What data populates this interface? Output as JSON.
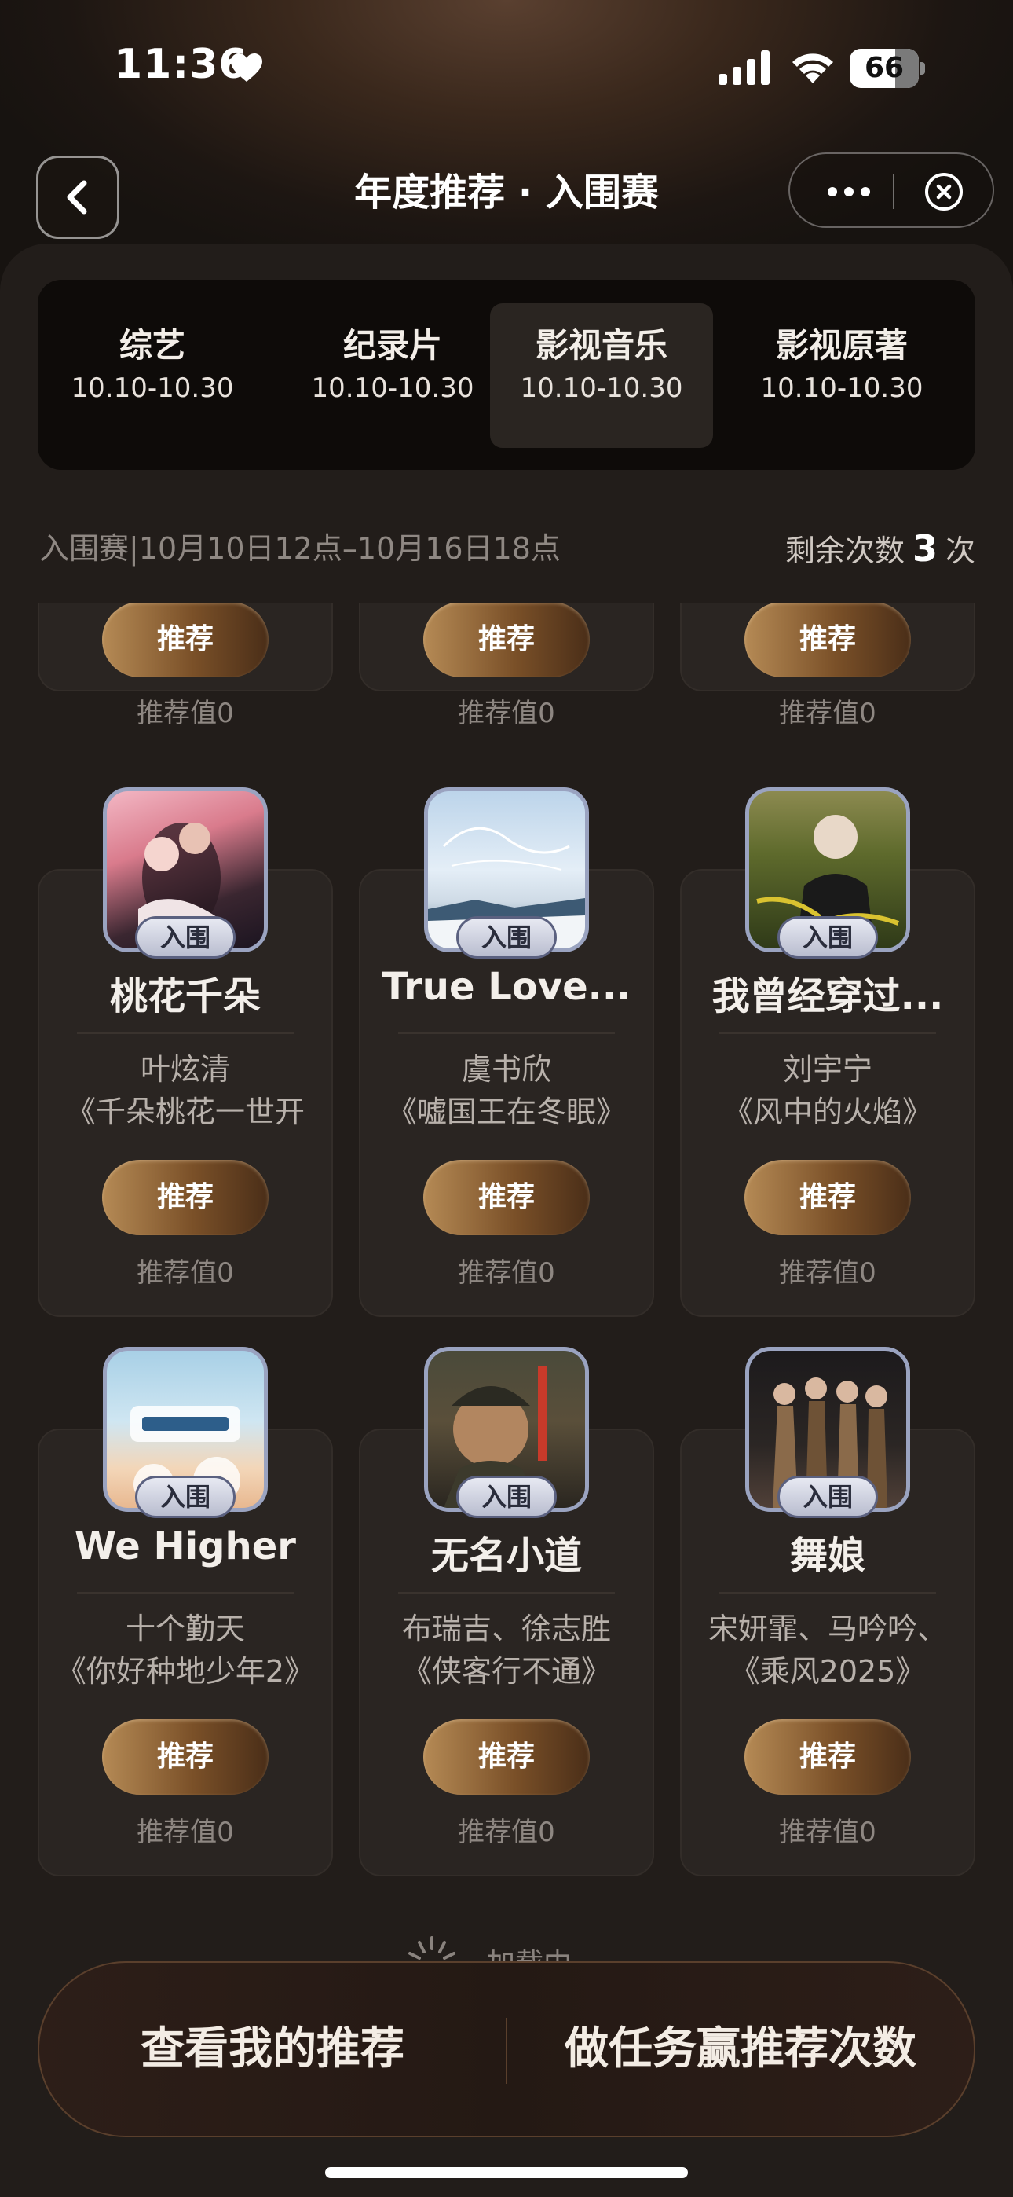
{
  "status_bar": {
    "time": "11:36",
    "battery": "66",
    "battery_level": 0.66
  },
  "nav": {
    "title": "年度推荐 · 入围赛"
  },
  "tabs": [
    {
      "name": "综艺",
      "date": "10.10-10.30",
      "active": false
    },
    {
      "name": "纪录片",
      "date": "10.10-10.30",
      "active": false
    },
    {
      "name": "影视音乐",
      "date": "10.10-10.30",
      "active": true
    },
    {
      "name": "影视原著",
      "date": "10.10-10.30",
      "active": false
    }
  ],
  "info": {
    "period": "入围赛|10月10日12点–10月16日18点",
    "remaining_label": "剩余次数",
    "remaining_count": "3",
    "remaining_unit": "次"
  },
  "partial_row": [
    {
      "button": "推荐",
      "value": "推荐值0"
    },
    {
      "button": "推荐",
      "value": "推荐值0"
    },
    {
      "button": "推荐",
      "value": "推荐值0"
    }
  ],
  "cards": [
    {
      "badge": "入围",
      "title": "桃花千朵",
      "artist": "叶炫清",
      "album": "《千朵桃花一世开",
      "button": "推荐",
      "value": "推荐值0"
    },
    {
      "badge": "入围",
      "title": "True Love...",
      "artist": "虞书欣",
      "album": "《嘘国王在冬眠》",
      "button": "推荐",
      "value": "推荐值0"
    },
    {
      "badge": "入围",
      "title": "我曾经穿过...",
      "artist": "刘宇宁",
      "album": "《风中的火焰》",
      "button": "推荐",
      "value": "推荐值0"
    },
    {
      "badge": "入围",
      "title": "We Higher",
      "artist": "十个勤天",
      "album": "《你好种地少年2》",
      "button": "推荐",
      "value": "推荐值0"
    },
    {
      "badge": "入围",
      "title": "无名小道",
      "artist": "布瑞吉、徐志胜",
      "album": "《侠客行不通》",
      "button": "推荐",
      "value": "推荐值0"
    },
    {
      "badge": "入围",
      "title": "舞娘",
      "artist": "宋妍霏、马吟吟、",
      "album": "《乘风2025》",
      "button": "推荐",
      "value": "推荐值0"
    }
  ],
  "loading": "加载中",
  "bottom": {
    "left": "查看我的推荐",
    "right": "做任务赢推荐次数"
  },
  "colors": {
    "accent": "#b58a55",
    "background": "#221d1a",
    "badge_border": "#5b6180"
  }
}
